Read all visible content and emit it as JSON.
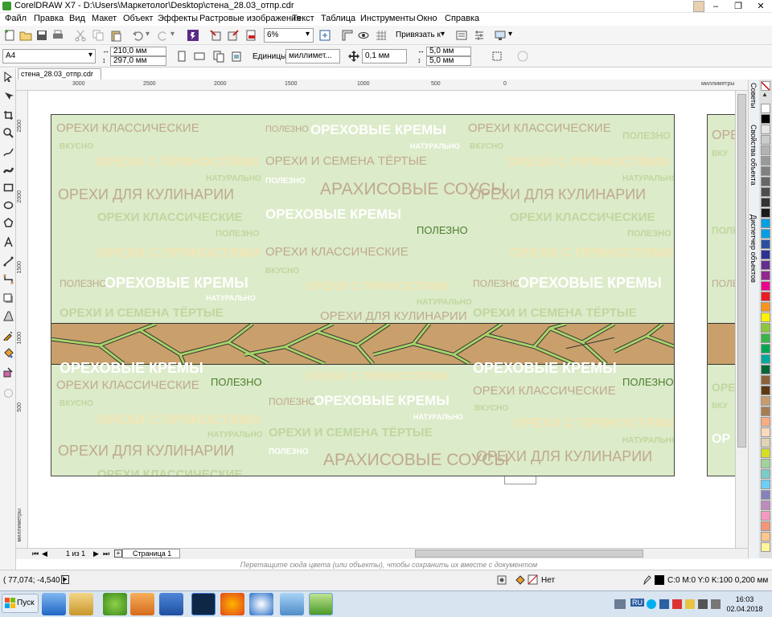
{
  "window": {
    "title": "CorelDRAW X7 - D:\\Users\\Маркетолог\\Desktop\\стена_28.03_отпр.cdr",
    "minimize": "–",
    "maximize": "❐",
    "close": "✕"
  },
  "menu": [
    "Файл",
    "Правка",
    "Вид",
    "Макет",
    "Объект",
    "Эффекты",
    "Растровые изображения",
    "Текст",
    "Таблица",
    "Инструменты",
    "Окно",
    "Справка"
  ],
  "toolbar": {
    "zoom": "6%",
    "snap_label": "Привязать к"
  },
  "property_bar": {
    "page_size": "A4",
    "width": "210,0 мм",
    "height": "297,0 мм",
    "units_label": "Единицы:",
    "units_value": "миллимет...",
    "nudge": "0,1 мм",
    "dup_x": "5,0 мм",
    "dup_y": "5,0 мм"
  },
  "document_tab": "стена_28.03_отпр.cdr",
  "ruler": {
    "h_ticks": [
      "3000",
      "2500",
      "2000",
      "1500",
      "1000",
      "500",
      "0"
    ],
    "h_unit": "миллиметры",
    "v_ticks": [
      "2500",
      "2000",
      "1500",
      "1000",
      "500"
    ],
    "v_unit": "миллиметры"
  },
  "design": {
    "texts": [
      "ОРЕХИ КЛАССИЧЕСКИЕ",
      "ПОЛЕЗНО",
      "ОРЕХОВЫЕ КРЕМЫ",
      "ОРЕХИ КЛАССИЧЕСКИЕ",
      "НАТУРАЛЬНО",
      "ВКУСНО",
      "ВКУСНО",
      "ПОЛЕЗНО",
      "ОРЕХИ С ПРЯНОСТЯМИ",
      "ОРЕХИ И СЕМЕНА ТЁРТЫЕ",
      "ОРЕХИ С ПРЯНОСТЯМИ",
      "НАТУРАЛЬНО",
      "ПОЛЕЗНО",
      "НАТУРАЛЬНО",
      "ОРЕХИ ДЛЯ КУЛИНАРИИ",
      "АРАХИСОВЫЕ СОУСЫ",
      "ОРЕХИ ДЛЯ КУЛИНАРИИ",
      "ОРЕХИ КЛАССИЧЕСКИЕ",
      "ОРЕХОВЫЕ КРЕМЫ",
      "ОРЕХИ КЛАССИЧЕСКИЕ",
      "ПОЛЕЗНО",
      "ПОЛЕЗНО",
      "ПОЛЕЗНО",
      "ОРЕХИ С ПРЯНОСТЯМИ",
      "ОРЕХИ КЛАССИЧЕСКИЕ",
      "ОРЕХИ С ПРЯНОСТЯМИ",
      "ВКУСНО",
      "ПОЛЕЗНО",
      "ОРЕХОВЫЕ КРЕМЫ",
      "ОРЕХИ С ПРЯНОСТЯМИ",
      "ПОЛЕЗНО",
      "ОРЕХОВЫЕ КРЕМЫ",
      "НАТУРАЛЬНО",
      "НАТУРАЛЬНО",
      "ОРЕХИ И СЕМЕНА ТЁРТЫЕ",
      "ОРЕХИ ДЛЯ КУЛИНАРИИ",
      "ОРЕХИ И СЕМЕНА ТЁРТЫЕ",
      "ОРЕХОВЫЕ КРЕМЫ",
      "ОРЕХИ С ПРЯНОСТЯМИ",
      "ОРЕХОВЫЕ КРЕМЫ",
      "ОРЕХИ КЛАССИЧЕСКИЕ",
      "ПОЛЕЗНО",
      "ОРЕХИ КЛАССИЧЕСКИЕ",
      "ПОЛЕЗНО",
      "ВКУСНО",
      "ПОЛЕЗНО",
      "ОРЕХОВЫЕ КРЕМЫ",
      "ВКУСНО",
      "НАТУРАЛЬНО",
      "ОРЕХИ С ПРЯНОСТЯМИ",
      "ОРЕХИ С ПРЯНОСТЯМИ",
      "НАТУРАЛЬНО",
      "ОРЕХИ И СЕМЕНА ТЁРТЫЕ",
      "НАТУРАЛЬНО",
      "ОРЕХИ ДЛЯ КУЛИНАРИИ",
      "ПОЛЕЗНО",
      "АРАХИСОВЫЕ СОУСЫ",
      "ОРЕХИ ДЛЯ КУЛИНАРИИ",
      "ОРЕХИ КЛАССИЧЕСКИЕ"
    ],
    "side_texts": [
      "ОРЕ",
      "ВКУ",
      "ПОЛЕ",
      "ПОЛЕ",
      "ОРЕ",
      "ВКУ",
      "ОР"
    ],
    "colors": {
      "background": "#dcebc9",
      "band": "#c9a06b",
      "band_lines": "#a8d46a"
    }
  },
  "page_nav": {
    "count": "1 из 1",
    "page_tab": "Страница 1"
  },
  "hint": "Перетащите сюда цвета (или объекты), чтобы сохранить их вместе с документом",
  "dockers": [
    "Советы",
    "Свойства объекта",
    "Диспетчер объектов"
  ],
  "palette": [
    "#ffffff",
    "#000000",
    "#e5e5e5",
    "#cccccc",
    "#b3b3b3",
    "#999999",
    "#808080",
    "#666666",
    "#4d4d4d",
    "#333333",
    "#1a1a1a",
    "#00a0e3",
    "#009fe3",
    "#2b4fa0",
    "#2e3192",
    "#662d91",
    "#92278f",
    "#ec008c",
    "#ed1c24",
    "#f7941d",
    "#fff200",
    "#8dc63f",
    "#39b54a",
    "#00a651",
    "#00a99d",
    "#006837",
    "#8c6239",
    "#603913",
    "#c69c6d",
    "#a67c52",
    "#f9ad81",
    "#fbd9bd",
    "#e1d4b2",
    "#d7df23",
    "#a3d39c",
    "#7accc8",
    "#6dcff6",
    "#8781bd",
    "#bd8cbf",
    "#f49ac1",
    "#f69679",
    "#fdc68a",
    "#fff799",
    "#c4df9b",
    "#82ca9d",
    "#6ecff6"
  ],
  "status": {
    "coords": "( 77,074; -4,540 )",
    "fill": "Нет",
    "outline": "C:0 M:0 Y:0 K:100  0,200 мм"
  },
  "taskbar": {
    "start": "Пуск",
    "lang": "RU",
    "time": "16:03",
    "date": "02.04.2018"
  }
}
